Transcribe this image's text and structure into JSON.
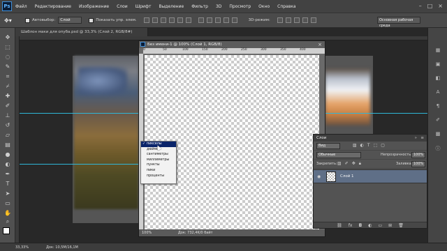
{
  "app": {
    "logo": "Ps",
    "menu": [
      "Файл",
      "Редактирование",
      "Изображение",
      "Слои",
      "Шрифт",
      "Выделение",
      "Фильтр",
      "3D",
      "Просмотр",
      "Окно",
      "Справка"
    ]
  },
  "options": {
    "autoselect_label": "Автовыбор:",
    "autoselect_value": "Слой",
    "show_controls_label": "Показать упр. элем.",
    "mode_3d_label": "3D-режим:",
    "workspace": "Основная рабочая среда"
  },
  "documents": {
    "main_tab": "Шаблон маки для опуба.psd @ 33,3% (Слой 2, RGB/8#)",
    "child_title": "Без имени-1 @ 100% (Слой 1, RGB/8)",
    "child_zoom": "100%",
    "child_docsize": "Док: 732,4K/0 байт",
    "ruler_ticks": [
      "0",
      "50",
      "100",
      "150",
      "200",
      "250",
      "300",
      "350",
      "400"
    ]
  },
  "units_menu": {
    "items": [
      "пикселы",
      "дюймы",
      "сантиметры",
      "миллиметры",
      "пункты",
      "пики",
      "проценты"
    ],
    "selected_index": 0,
    "check": "✓"
  },
  "layers_panel": {
    "title": "Слои",
    "filter_label": "Вид",
    "blend_mode": "Обычные",
    "opacity_label": "Непрозрачность:",
    "opacity_value": "100%",
    "lock_label": "Закрепить:",
    "fill_label": "Заливка:",
    "fill_value": "100%",
    "layer_name": "Слой 1"
  },
  "status": {
    "zoom": "33,33%",
    "docsize": "Док: 10,5M/16,1M"
  },
  "colors": {
    "guide": "#2fb7d8",
    "menu_selected": "#0a246a",
    "layer_selected": "#5f6f87"
  }
}
